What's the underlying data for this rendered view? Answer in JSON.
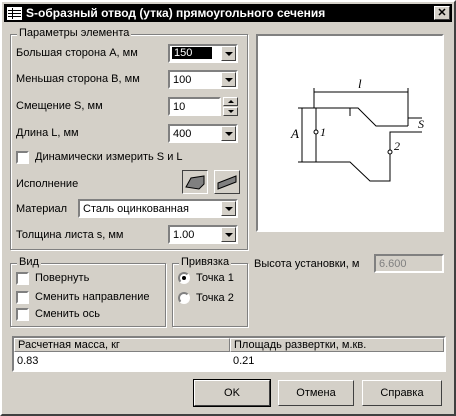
{
  "window": {
    "title": "S-образный отвод (утка) прямоугольного сечения",
    "close_glyph": "✕"
  },
  "params": {
    "group_title": "Параметры элемента",
    "side_a": {
      "label": "Большая сторона A, мм",
      "value": "150"
    },
    "side_b": {
      "label": "Меньшая сторона B, мм",
      "value": "100"
    },
    "offset_s": {
      "label": "Смещение S, мм",
      "value": "10"
    },
    "length_l": {
      "label": "Длина L, мм",
      "value": "400"
    },
    "dynamic_measure": {
      "label": "Динамически измерить S и L",
      "checked": false
    },
    "execution_label": "Исполнение",
    "material": {
      "label": "Материал",
      "value": "Сталь оцинкованная"
    },
    "thickness": {
      "label": "Толщина листа s, мм",
      "value": "1.00"
    }
  },
  "view": {
    "group_title": "Вид",
    "rotate": "Повернуть",
    "change_direction": "Сменить направление",
    "change_axis": "Сменить  ось"
  },
  "binding": {
    "group_title": "Привязка",
    "point1": "Точка 1",
    "point2": "Точка 2",
    "selected": "Точка 1"
  },
  "install_height": {
    "label": "Высота установки, м",
    "value": "6.600"
  },
  "drawing": {
    "label_l": "l",
    "label_a": "A",
    "label_s": "S",
    "point1": "1",
    "point2": "2"
  },
  "results": {
    "headers": [
      "Расчетная масса, кг",
      "Площадь развертки, м.кв."
    ],
    "values": [
      "0.83",
      "0.21"
    ]
  },
  "buttons": {
    "ok": "OK",
    "cancel": "Отмена",
    "help": "Справка"
  }
}
